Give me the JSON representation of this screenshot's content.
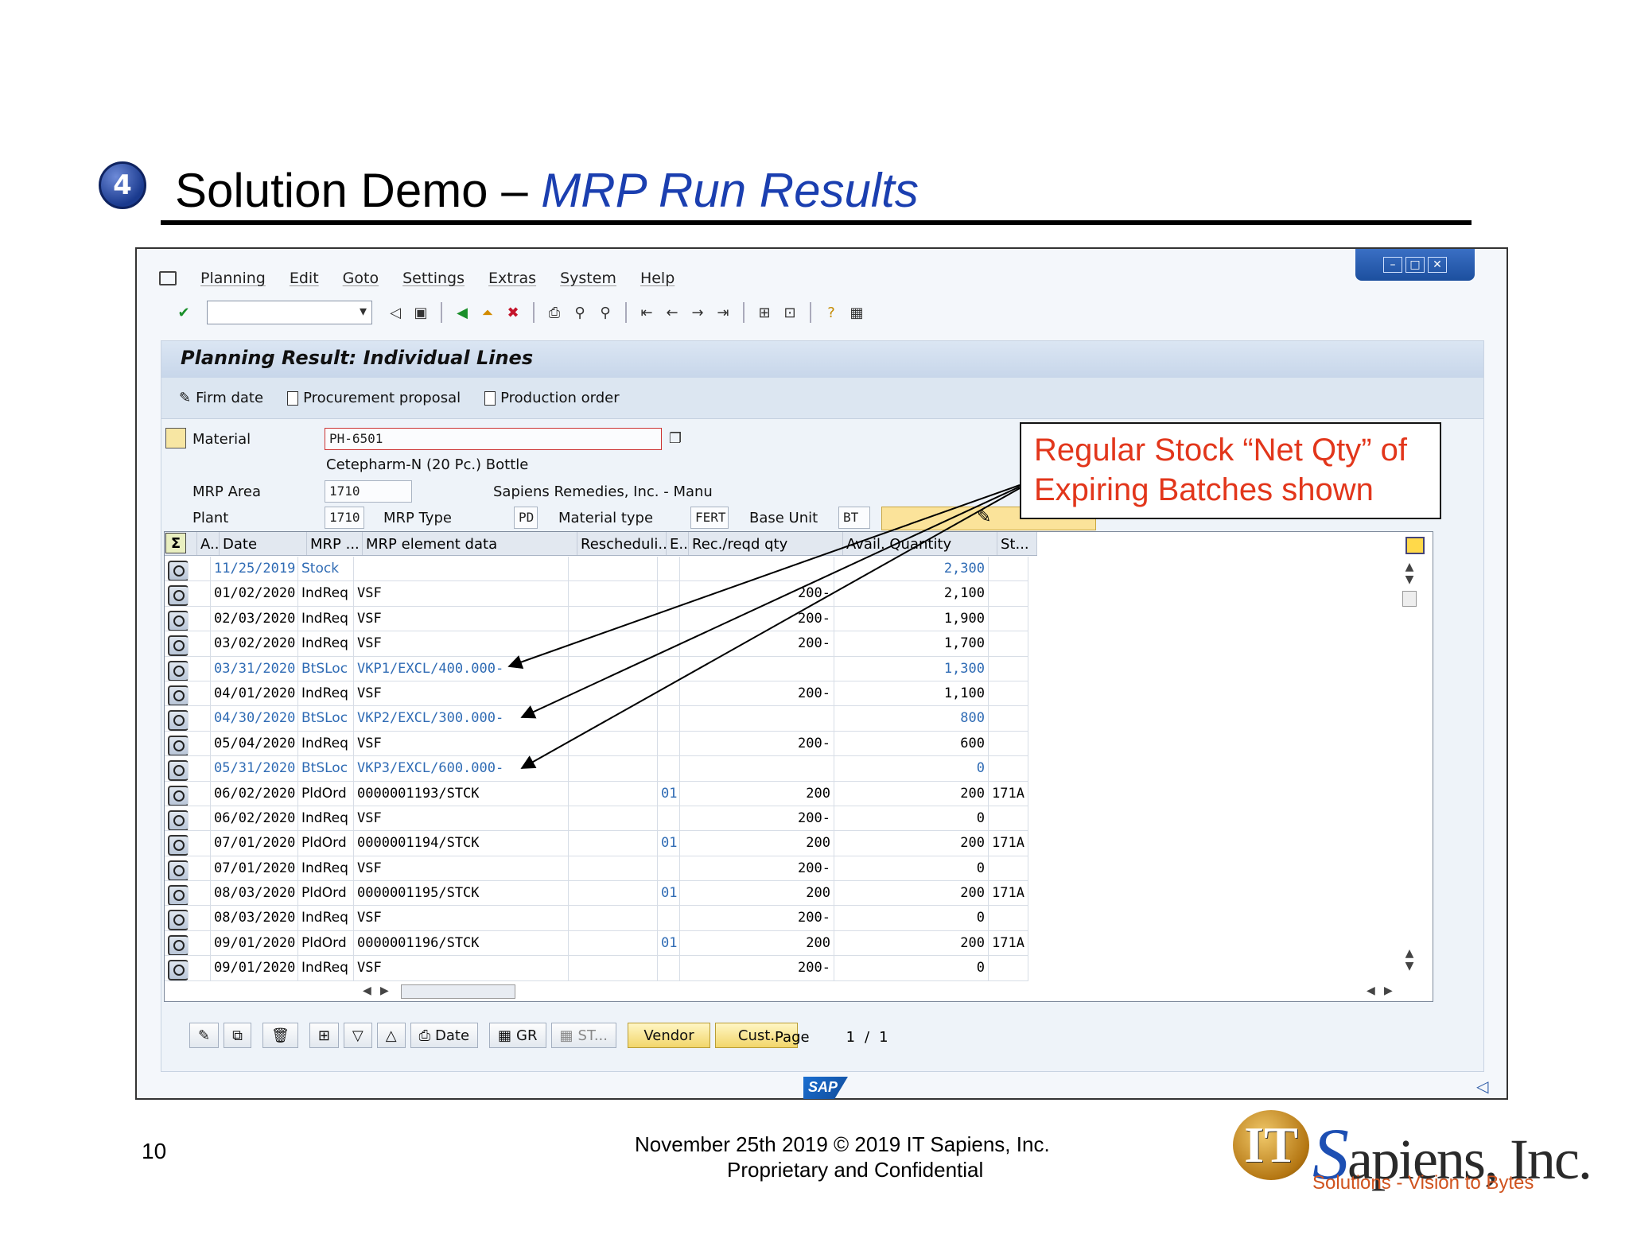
{
  "slide": {
    "step_number": "4",
    "title_main": "Solution Demo – ",
    "title_accent": "MRP Run Results",
    "page_number": "10",
    "footer_line1": "November 25th  2019     © 2019 IT Sapiens, Inc.",
    "footer_line2": "Proprietary and Confidential",
    "logo_name": "Sapiens, Inc.",
    "logo_s": "S",
    "logo_rest": "apiens, Inc.",
    "logo_it": "IT",
    "logo_tagline": "Solutions - Vision to Bytes"
  },
  "menu": [
    "Planning",
    "Edit",
    "Goto",
    "Settings",
    "Extras",
    "System",
    "Help"
  ],
  "panel": {
    "title": "Planning Result: Individual Lines",
    "actions": [
      "Firm date",
      "Procurement proposal",
      "Production order"
    ]
  },
  "header": {
    "material_label": "Material",
    "material_value": "PH-6501",
    "material_desc": "Cetepharm-N (20 Pc.) Bottle",
    "mrp_area_label": "MRP Area",
    "mrp_area_value": "1710",
    "mrp_area_desc": "Sapiens Remedies, Inc. - Manu",
    "plant_label": "Plant",
    "plant_value": "1710",
    "mrp_type_label": "MRP Type",
    "mrp_type_value": "PD",
    "material_type_label": "Material type",
    "material_type_value": "FERT",
    "base_unit_label": "Base Unit",
    "base_unit_value": "BT"
  },
  "grid": {
    "columns": [
      "A..",
      "Date",
      "MRP ...",
      "MRP element data",
      "Rescheduli...",
      "E..",
      "Rec./reqd qty",
      "Avail. Quantity",
      "St..."
    ],
    "rows": [
      {
        "date": "11/25/2019",
        "mrp": "Stock",
        "element": "",
        "res": "",
        "e": "",
        "rec": "",
        "avail": "2,300",
        "st": "",
        "blue": true
      },
      {
        "date": "01/02/2020",
        "mrp": "IndReq",
        "element": "VSF",
        "res": "",
        "e": "",
        "rec": "200-",
        "avail": "2,100",
        "st": "",
        "blue": false
      },
      {
        "date": "02/03/2020",
        "mrp": "IndReq",
        "element": "VSF",
        "res": "",
        "e": "",
        "rec": "200-",
        "avail": "1,900",
        "st": "",
        "blue": false
      },
      {
        "date": "03/02/2020",
        "mrp": "IndReq",
        "element": "VSF",
        "res": "",
        "e": "",
        "rec": "200-",
        "avail": "1,700",
        "st": "",
        "blue": false
      },
      {
        "date": "03/31/2020",
        "mrp": "BtSLoc",
        "element": "VKP1/EXCL/400.000-",
        "res": "",
        "e": "",
        "rec": "",
        "avail": "1,300",
        "st": "",
        "blue": true
      },
      {
        "date": "04/01/2020",
        "mrp": "IndReq",
        "element": "VSF",
        "res": "",
        "e": "",
        "rec": "200-",
        "avail": "1,100",
        "st": "",
        "blue": false
      },
      {
        "date": "04/30/2020",
        "mrp": "BtSLoc",
        "element": "VKP2/EXCL/300.000-",
        "res": "",
        "e": "",
        "rec": "",
        "avail": "800",
        "st": "",
        "blue": true
      },
      {
        "date": "05/04/2020",
        "mrp": "IndReq",
        "element": "VSF",
        "res": "",
        "e": "",
        "rec": "200-",
        "avail": "600",
        "st": "",
        "blue": false
      },
      {
        "date": "05/31/2020",
        "mrp": "BtSLoc",
        "element": "VKP3/EXCL/600.000-",
        "res": "",
        "e": "",
        "rec": "",
        "avail": "0",
        "st": "",
        "blue": true
      },
      {
        "date": "06/02/2020",
        "mrp": "PldOrd",
        "element": "0000001193/STCK",
        "res": "",
        "e": "01",
        "rec": "200",
        "avail": "200",
        "st": "171A",
        "blue": false
      },
      {
        "date": "06/02/2020",
        "mrp": "IndReq",
        "element": "VSF",
        "res": "",
        "e": "",
        "rec": "200-",
        "avail": "0",
        "st": "",
        "blue": false
      },
      {
        "date": "07/01/2020",
        "mrp": "PldOrd",
        "element": "0000001194/STCK",
        "res": "",
        "e": "01",
        "rec": "200",
        "avail": "200",
        "st": "171A",
        "blue": false
      },
      {
        "date": "07/01/2020",
        "mrp": "IndReq",
        "element": "VSF",
        "res": "",
        "e": "",
        "rec": "200-",
        "avail": "0",
        "st": "",
        "blue": false
      },
      {
        "date": "08/03/2020",
        "mrp": "PldOrd",
        "element": "0000001195/STCK",
        "res": "",
        "e": "01",
        "rec": "200",
        "avail": "200",
        "st": "171A",
        "blue": false
      },
      {
        "date": "08/03/2020",
        "mrp": "IndReq",
        "element": "VSF",
        "res": "",
        "e": "",
        "rec": "200-",
        "avail": "0",
        "st": "",
        "blue": false
      },
      {
        "date": "09/01/2020",
        "mrp": "PldOrd",
        "element": "0000001196/STCK",
        "res": "",
        "e": "01",
        "rec": "200",
        "avail": "200",
        "st": "171A",
        "blue": false
      },
      {
        "date": "09/01/2020",
        "mrp": "IndReq",
        "element": "VSF",
        "res": "",
        "e": "",
        "rec": "200-",
        "avail": "0",
        "st": "",
        "blue": false
      }
    ]
  },
  "bottom": {
    "date_label": "Date",
    "gr_label": "GR",
    "st_label": "ST...",
    "vendor_label": "Vendor",
    "cust_label": "Cust.",
    "page_label": "Page",
    "page_current": "1",
    "page_sep": "/",
    "page_total": "1"
  },
  "sap_logo": "SAP",
  "callout": {
    "line1": "Regular Stock “Net Qty” of",
    "line2": "Expiring Batches shown"
  }
}
